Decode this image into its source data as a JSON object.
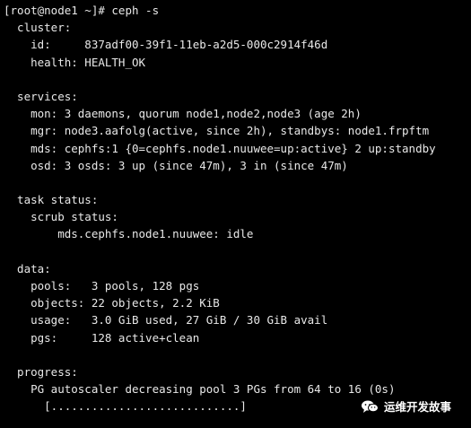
{
  "terminal": {
    "prompt": "[root@node1 ~]# ceph -s",
    "cluster": {
      "header": "  cluster:",
      "id": "    id:     837adf00-39f1-11eb-a2d5-000c2914f46d",
      "health": "    health: HEALTH_OK"
    },
    "services": {
      "header": "  services:",
      "mon": "    mon: 3 daemons, quorum node1,node2,node3 (age 2h)",
      "mgr": "    mgr: node3.aafolg(active, since 2h), standbys: node1.frpftm",
      "mds": "    mds: cephfs:1 {0=cephfs.node1.nuuwee=up:active} 2 up:standby",
      "osd": "    osd: 3 osds: 3 up (since 47m), 3 in (since 47m)"
    },
    "task_status": {
      "header": "  task status:",
      "scrub": "    scrub status:",
      "mds_line": "        mds.cephfs.node1.nuuwee: idle"
    },
    "data": {
      "header": "  data:",
      "pools": "    pools:   3 pools, 128 pgs",
      "objects": "    objects: 22 objects, 2.2 KiB",
      "usage": "    usage:   3.0 GiB used, 27 GiB / 30 GiB avail",
      "pgs": "    pgs:     128 active+clean"
    },
    "progress": {
      "header": "  progress:",
      "line": "    PG autoscaler decreasing pool 3 PGs from 64 to 16 (0s)",
      "bar": "      [............................]"
    }
  },
  "watermark": {
    "icon": "wechat-icon",
    "text": "运维开发故事"
  }
}
